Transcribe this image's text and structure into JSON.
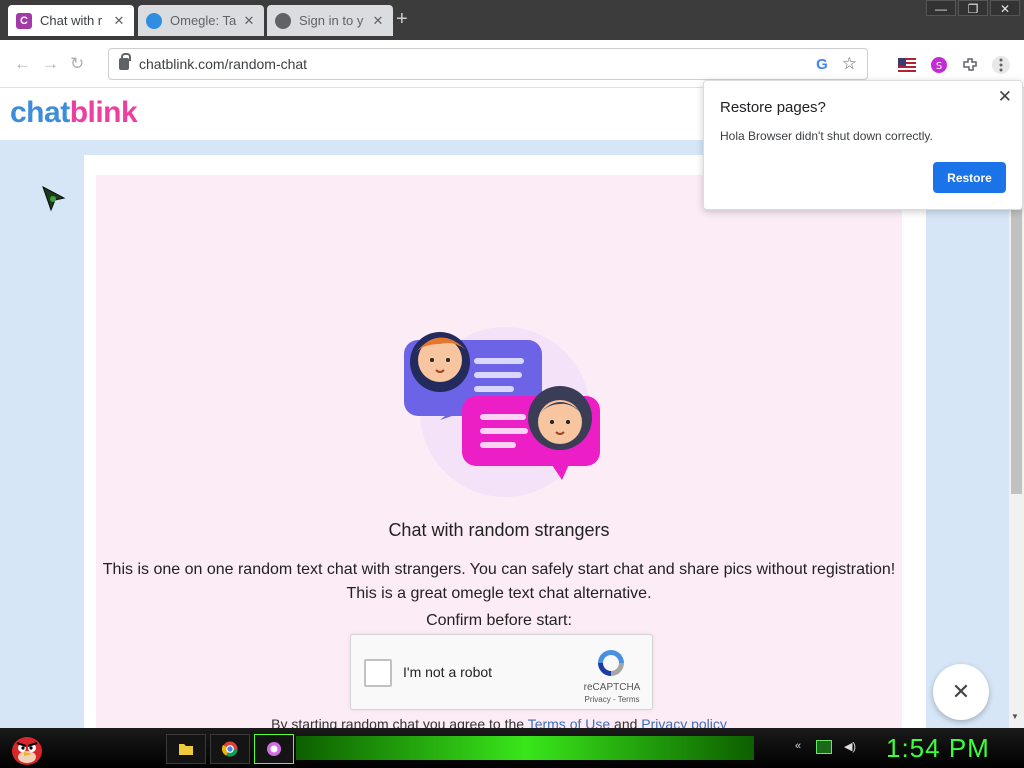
{
  "browser": {
    "tabs": [
      {
        "title": "Chat with r",
        "favicon": "C",
        "favicon_color": "#a23aa8"
      },
      {
        "title": "Omegle: Ta",
        "favicon": "omegle-icon",
        "favicon_color": "#2e8ee0"
      },
      {
        "title": "Sign in to y",
        "favicon": "globe-icon",
        "favicon_color": "#5f6368"
      }
    ],
    "new_tab": "+",
    "url": "chatblink.com/random-chat"
  },
  "site": {
    "logo_part1": "chat",
    "logo_part2": "blink",
    "headline": "Chat with random strangers",
    "desc_line1": "This is one on one random text chat with strangers. You can safely start chat and share pics without registration!",
    "desc_line2": "This is a great omegle text chat alternative.",
    "confirm": "Confirm before start:",
    "terms_pre": "By starting random chat you agree to the",
    "terms_link": "Terms of Use",
    "terms_mid": "and",
    "privacy_link": "Privacy policy"
  },
  "recaptcha": {
    "label": "I'm not a robot",
    "brand": "reCAPTCHA",
    "links": "Privacy - Terms"
  },
  "restore_bubble": {
    "title": "Restore pages?",
    "message": "Hola Browser didn't shut down correctly.",
    "button": "Restore"
  },
  "taskbar": {
    "clock": "1:54 PM"
  },
  "colors": {
    "brand_blue": "#3d8ddb",
    "brand_pink": "#ec3f9f",
    "restore_button": "#1a73e8",
    "clock": "#3cff3c"
  }
}
